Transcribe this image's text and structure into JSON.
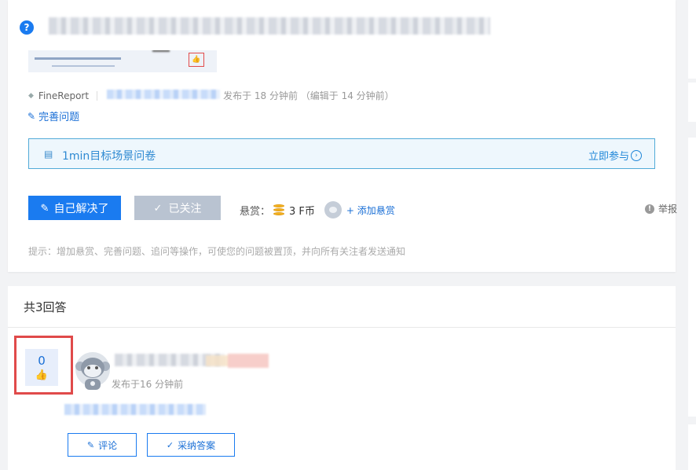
{
  "question": {
    "thumbnail_icon": "thumbs-up-icon",
    "product_tag": "FineReport",
    "published_time": "发布于 18 分钟前 （编辑于 14 分钟前）",
    "improve_label": "完善问题"
  },
  "survey": {
    "title": "1min目标场景问卷",
    "join_label": "立即参与",
    "colors": {
      "border": "#52abd8",
      "background": "#eef7fd"
    }
  },
  "actions": {
    "solve_label": "自己解决了",
    "follow_label": "已关注",
    "reward_label": "悬赏：",
    "reward_amount": "3 F币",
    "add_reward_label": "+ 添加悬赏",
    "report_label": "举报",
    "hint": "提示：增加悬赏、完善问题、追问等操作，可使您的问题被置顶，并向所有关注者发送通知"
  },
  "answers": {
    "count_label": "共3回答",
    "items": [
      {
        "votes": "0",
        "published_time": "发布于16 分钟前",
        "comment_label": "评论",
        "accept_label": "采纳答案"
      }
    ]
  },
  "colors": {
    "primary": "#1a7bf0",
    "disabled_button": "#b9c3d1",
    "highlight_frame": "#e04a4a",
    "page_background": "#f2f3f5"
  }
}
